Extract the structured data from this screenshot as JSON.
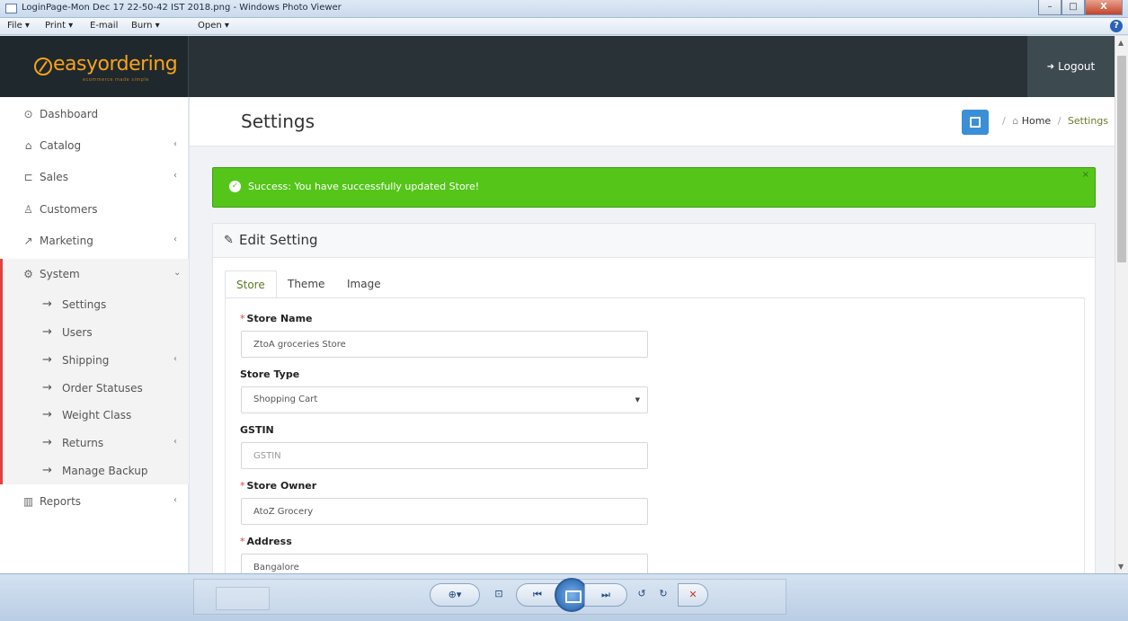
{
  "window": {
    "title": "LoginPage-Mon Dec 17 22-50-42 IST 2018.png - Windows Photo Viewer",
    "menu": [
      "File ▾",
      "Print ▾",
      "E-mail",
      "Burn ▾",
      "Open ▾"
    ],
    "minimize_label": "–",
    "maximize_label": "□",
    "close_label": "X",
    "help_label": "?"
  },
  "app": {
    "logo_text": "easyordering",
    "logo_sub": "ecommerce made simple",
    "logout_label": "Logout"
  },
  "sidebar": {
    "items": [
      {
        "label": "Dashboard",
        "icon": "dashboard-icon",
        "glyph": "⊙",
        "chevron": ""
      },
      {
        "label": "Catalog",
        "icon": "tag-icon",
        "glyph": "⌂",
        "chevron": "‹"
      },
      {
        "label": "Sales",
        "icon": "cart-icon",
        "glyph": "⊏",
        "chevron": "‹"
      },
      {
        "label": "Customers",
        "icon": "user-icon",
        "glyph": "♙",
        "chevron": ""
      },
      {
        "label": "Marketing",
        "icon": "share-icon",
        "glyph": "↗",
        "chevron": "‹"
      },
      {
        "label": "System",
        "icon": "gear-icon",
        "glyph": "⚙",
        "chevron": "⌄"
      },
      {
        "label": "Reports",
        "icon": "bar-chart-icon",
        "glyph": "▥",
        "chevron": "‹"
      }
    ],
    "system_children": [
      {
        "label": "Settings",
        "chevron": ""
      },
      {
        "label": "Users",
        "chevron": ""
      },
      {
        "label": "Shipping",
        "chevron": "‹"
      },
      {
        "label": "Order Statuses",
        "chevron": ""
      },
      {
        "label": "Weight Class",
        "chevron": ""
      },
      {
        "label": "Returns",
        "chevron": "‹"
      },
      {
        "label": "Manage Backup",
        "chevron": ""
      }
    ],
    "arrow_glyph": "→"
  },
  "header": {
    "title": "Settings",
    "breadcrumb_sep": "/",
    "breadcrumb_home": "Home",
    "breadcrumb_current": "Settings"
  },
  "alert": {
    "text": "Success: You have successfully updated Store!",
    "close": "×"
  },
  "panel": {
    "title": "Edit Setting",
    "tabs": [
      "Store",
      "Theme",
      "Image"
    ],
    "active_tab": "Store"
  },
  "form": {
    "store_name": {
      "label": "Store Name",
      "required": true,
      "value": "ZtoA groceries Store"
    },
    "store_type": {
      "label": "Store Type",
      "selected": "Shopping Cart"
    },
    "gstin": {
      "label": "GSTIN",
      "placeholder": "GSTIN",
      "value": ""
    },
    "store_owner": {
      "label": "Store Owner",
      "required": true,
      "value": "AtoZ Grocery"
    },
    "address": {
      "label": "Address",
      "required": true,
      "value": "Bangalore"
    }
  },
  "viewer_controls": [
    "⊕▾",
    "⊡",
    "⏮",
    "⏭",
    "↺",
    "↻",
    "✕"
  ],
  "colors": {
    "topbar": "#283237",
    "logo": "#f7a31c",
    "success": "#55c51a",
    "active_tab": "#5c7a22",
    "system_marker": "#e2413f",
    "primary_button": "#3b8fd6"
  }
}
